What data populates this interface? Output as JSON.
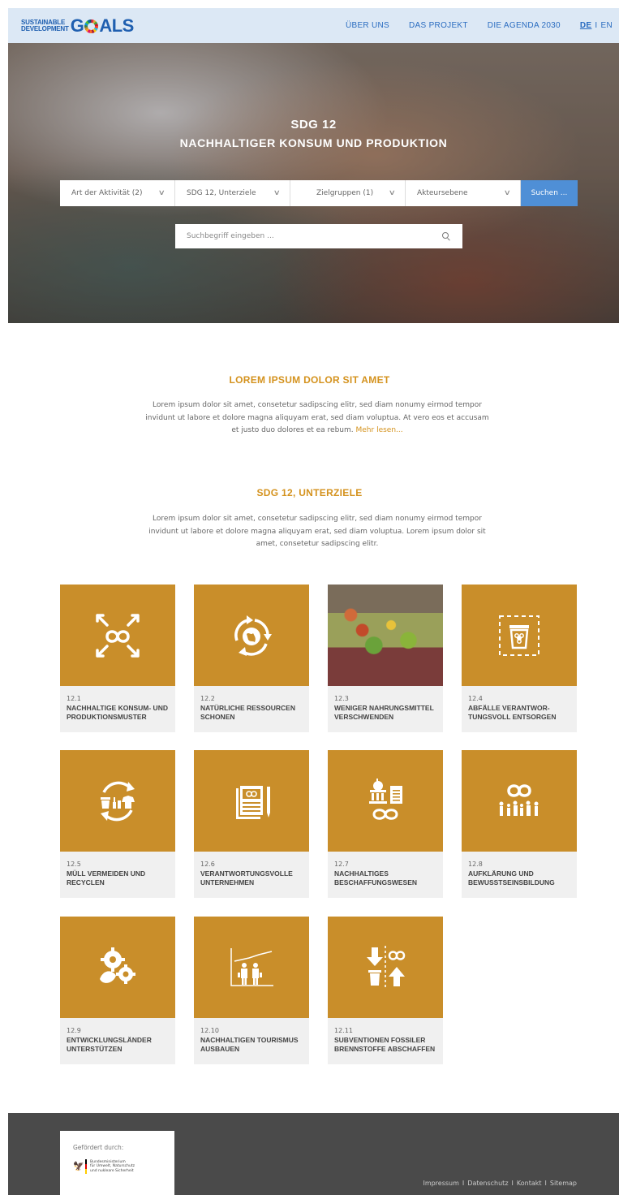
{
  "header": {
    "logo_small_line1": "SUSTAINABLE",
    "logo_small_line2": "DEVELOPMENT",
    "logo_big_left": "G",
    "logo_big_right": "ALS",
    "nav": [
      "ÜBER UNS",
      "DAS PROJEKT",
      "DIE AGENDA 2030"
    ],
    "lang_de": "DE",
    "lang_sep": "I",
    "lang_en": "EN"
  },
  "hero": {
    "title": "SDG 12",
    "subtitle": "NACHHALTIGER KONSUM UND PRODUKTION",
    "filters": [
      "Art der Aktivität (2)",
      "SDG 12, Unterziele",
      "Zielgruppen (1)",
      "Akteursebene"
    ],
    "search_button": "Suchen ...",
    "search_placeholder": "Suchbegriff eingeben ..."
  },
  "intro": {
    "title": "LOREM IPSUM DOLOR SIT AMET",
    "text": "Lorem ipsum dolor sit amet, consetetur sadipscing elitr, sed diam nonumy eirmod tempor invidunt ut labore et dolore magna aliquyam erat, sed diam voluptua. At vero eos et accusam et justo duo dolores et ea rebum.",
    "more": "Mehr lesen..."
  },
  "targets": {
    "title": "SDG 12, UNTERZIELE",
    "text": "Lorem ipsum dolor sit amet, consetetur sadipscing elitr, sed diam nonumy eirmod tempor invidunt ut labore et dolore magna aliquyam erat, sed diam voluptua. Lorem ipsum dolor sit amet, consetetur sadipscing elitr.",
    "items": [
      {
        "num": "12.1",
        "name": "NACHHALTIGE KONSUM- UND PRODUKTIONSMUSTER",
        "icon": "infinity-arrows-icon"
      },
      {
        "num": "12.2",
        "name": "NATÜRLICHE RESSOURCEN SCHONEN",
        "icon": "globe-cycle-icon"
      },
      {
        "num": "12.3",
        "name": "WENIGER NAHRUNGSMITTEL VERSCHWENDEN",
        "icon": "food-waste-photo"
      },
      {
        "num": "12.4",
        "name": "ABFÄLLE VERANTWOR-TUNGSVOLL ENTSORGEN",
        "icon": "hazard-bin-icon"
      },
      {
        "num": "12.5",
        "name": "MÜLL VERMEIDEN UND RECYCLEN",
        "icon": "recycle-icon"
      },
      {
        "num": "12.6",
        "name": "VERANTWORTUNGSVOLLE UNTERNEHMEN",
        "icon": "report-pen-icon"
      },
      {
        "num": "12.7",
        "name": "NACHHALTIGES BESCHAFFUNGSWESEN",
        "icon": "public-procurement-icon"
      },
      {
        "num": "12.8",
        "name": "AUFKLÄRUNG UND BEWUSSTSEINSBILDUNG",
        "icon": "people-infinity-icon"
      },
      {
        "num": "12.9",
        "name": "ENTWICKLUNGSLÄNDER UNTERSTÜTZEN",
        "icon": "gears-leaf-icon"
      },
      {
        "num": "12.10",
        "name": "NACHHALTIGEN TOURISMUS AUSBAUEN",
        "icon": "tourism-chart-icon"
      },
      {
        "num": "12.11",
        "name": "SUBVENTIONEN FOSSILER BRENNSTOFFE ABSCHAFFEN",
        "icon": "subsidy-arrows-icon"
      }
    ]
  },
  "footer": {
    "funded_by": "Gefördert durch:",
    "ministry": [
      "Bundesministerium",
      "für Umwelt, Naturschutz",
      "und nukleare Sicherheit"
    ],
    "links": [
      "Impressum",
      "Datenschutz",
      "Kontakt",
      "Sitemap"
    ],
    "separator": "I"
  },
  "colors": {
    "accent": "#d4921d",
    "tile": "#c98e2a",
    "header_bg": "#dce8f5",
    "nav": "#2a6cc0",
    "button": "#4f8fd6",
    "footer": "#4a4a4a"
  }
}
